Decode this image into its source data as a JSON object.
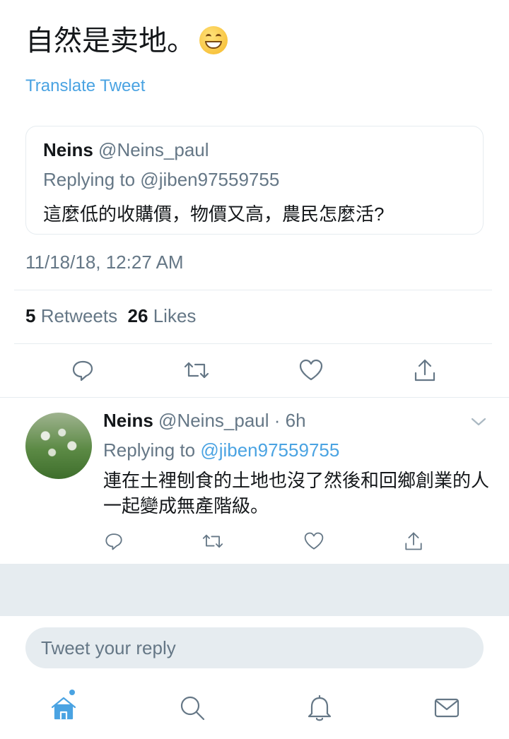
{
  "main_tweet": {
    "text": "自然是卖地。",
    "emoji": "grinning-face",
    "translate_label": "Translate Tweet"
  },
  "quoted_tweet": {
    "name": "Neins",
    "handle": "@Neins_paul",
    "replying_to": "Replying to @jiben97559755",
    "text": "這麼低的收購價，物價又高，農民怎麼活?"
  },
  "timestamp": "11/18/18, 12:27 AM",
  "stats": {
    "retweets_count": "5",
    "retweets_label": "Retweets",
    "likes_count": "26",
    "likes_label": "Likes"
  },
  "reply": {
    "name": "Neins",
    "handle_time": "@Neins_paul · 6h",
    "replying_prefix": "Replying to ",
    "replying_handle": "@jiben97559755",
    "text": "連在土裡刨食的土地也沒了然後和回鄉創業的人一起變成無產階級。"
  },
  "compose": {
    "placeholder": "Tweet your reply"
  },
  "tab_bar": {
    "items": [
      "home-icon",
      "search-icon",
      "notifications-icon",
      "messages-icon"
    ],
    "active": "home-icon"
  },
  "colors": {
    "accent": "#4aa3e2",
    "secondary_text": "#657786",
    "divider": "#e6ecf0"
  }
}
